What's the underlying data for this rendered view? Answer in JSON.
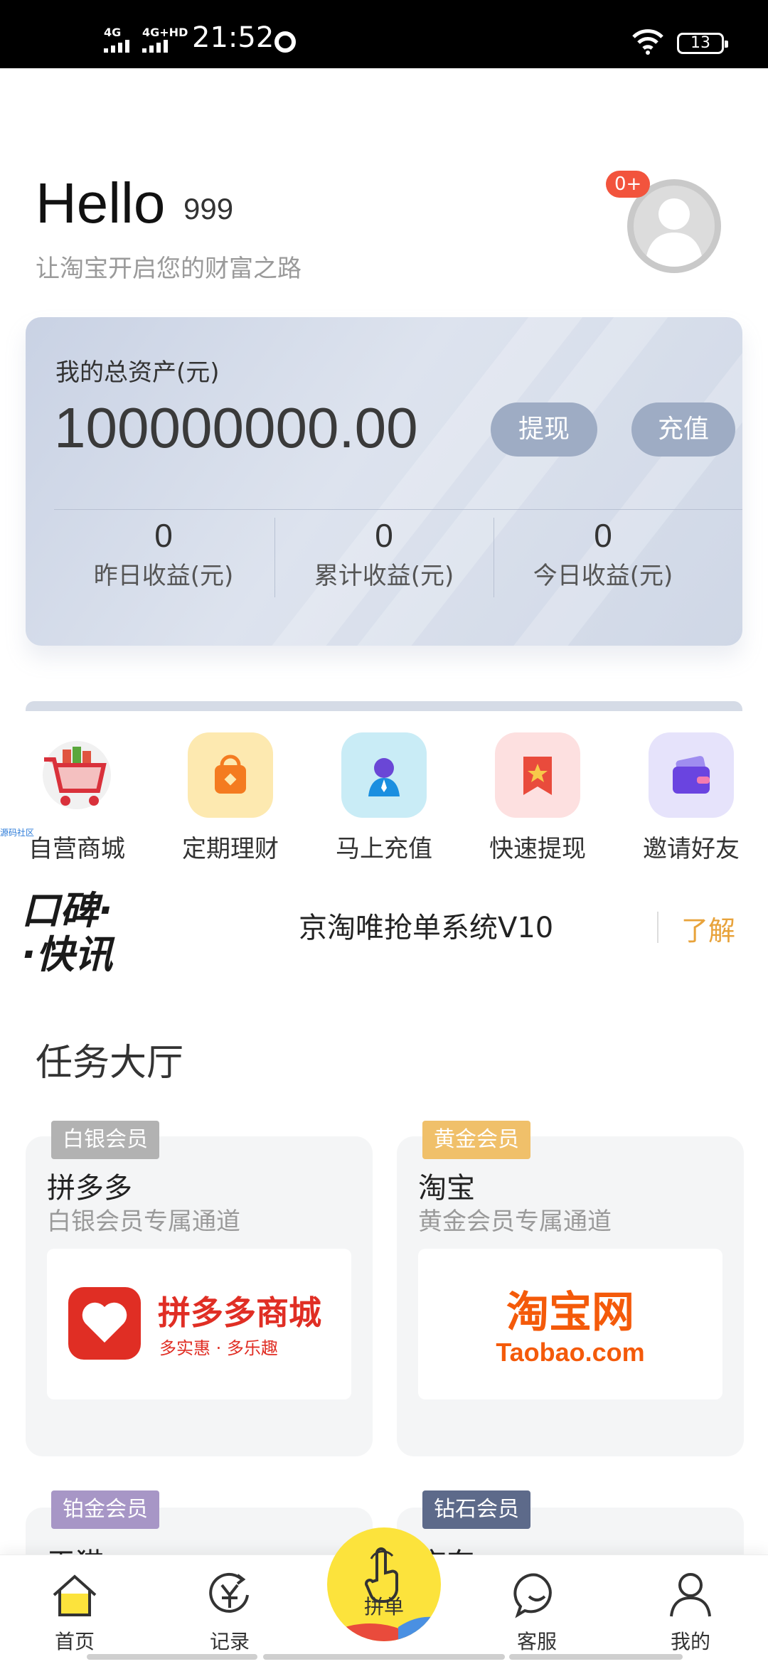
{
  "status_bar": {
    "network1": "4G",
    "network2": "4G+HD",
    "time": "21:52",
    "battery": "13"
  },
  "header": {
    "hello": "Hello",
    "username": "999",
    "subtitle": "让淘宝开启您的财富之路",
    "badge": "0+"
  },
  "asset_card": {
    "label": "我的总资产(元)",
    "value": "100000000.00",
    "withdraw": "提现",
    "recharge": "充值",
    "stats": [
      {
        "value": "0",
        "label": "昨日收益(元)"
      },
      {
        "value": "0",
        "label": "累计收益(元)"
      },
      {
        "value": "0",
        "label": "今日收益(元)"
      }
    ]
  },
  "quick_actions": [
    {
      "label": "自营商城",
      "icon": "shopping-cart-icon"
    },
    {
      "label": "定期理财",
      "icon": "orange-bag-icon"
    },
    {
      "label": "马上充值",
      "icon": "person-icon"
    },
    {
      "label": "快速提现",
      "icon": "bookmark-star-icon"
    },
    {
      "label": "邀请好友",
      "icon": "wallet-icon"
    }
  ],
  "tiny_link": "源码社区",
  "news": {
    "logo_line1": "口碑·",
    "logo_line2": "·快讯",
    "text": "京淘唯抢单系统V10",
    "more": "了解"
  },
  "section_title": "任务大厅",
  "tasks": [
    {
      "tag": "白银会员",
      "tag_color": "#b2b2b2",
      "name": "拼多多",
      "desc": "白银会员专属通道",
      "logo_title": "拼多多商城",
      "logo_sub": "多实惠 · 多乐趣"
    },
    {
      "tag": "黄金会员",
      "tag_color": "#f0c06a",
      "name": "淘宝",
      "desc": "黄金会员专属通道",
      "logo_title": "淘宝网",
      "logo_sub": "Taobao.com"
    },
    {
      "tag": "铂金会员",
      "tag_color": "#a796c6",
      "name": "天猫"
    },
    {
      "tag": "钻石会员",
      "tag_color": "#5d6a8a",
      "name": "京东"
    }
  ],
  "bottom_nav": {
    "home": "首页",
    "records": "记录",
    "pin": "拼单",
    "service": "客服",
    "mine": "我的"
  },
  "colors": {
    "accent_yellow": "#fce33c",
    "badge_red": "#f2543d",
    "news_more": "#e8a33b"
  }
}
